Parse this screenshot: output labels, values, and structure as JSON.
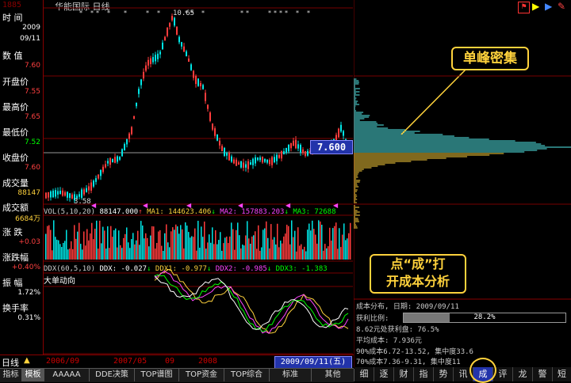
{
  "window": {
    "title": "华能国际 日线",
    "top_left_number": "1885"
  },
  "left_panel": {
    "items": [
      {
        "label": "时  间",
        "value": "2009"
      },
      {
        "label": "",
        "value": "09/11"
      },
      {
        "label": "数  值",
        "value": "7.60"
      },
      {
        "label": "开盘价",
        "value": "7.55"
      },
      {
        "label": "最高价",
        "value": "7.65"
      },
      {
        "label": "最低价",
        "value": "7.52"
      },
      {
        "label": "收盘价",
        "value": "7.60"
      },
      {
        "label": "成交量",
        "value": "88147"
      },
      {
        "label": "成交额",
        "value": "6684万"
      },
      {
        "label": "涨  跌",
        "value": "+0.03"
      },
      {
        "label": "涨跌幅",
        "value": "+0.40%"
      },
      {
        "label": "振  幅",
        "value": "1.72%"
      },
      {
        "label": "换手率",
        "value": "0.31%"
      }
    ]
  },
  "chart": {
    "peak_label": "10.65",
    "low_label": "3.58",
    "price_tag": "7.600",
    "vol_line": {
      "name": "VOL(5,10,20)",
      "v1": "88147.000",
      "ma1": "MA1: 144623.406",
      "ma2": "MA2: 157883.203",
      "ma3": "MA3: 72688"
    },
    "ddx_line": {
      "name": "DDX(60,5,10)",
      "ddx": "DDX: -0.027",
      "ddx1": "DDX1: -0.977",
      "ddx2": "DDX2: -0.985",
      "ddx3": "DDX3: -1.383"
    },
    "big_order_label": "大单动向"
  },
  "callouts": {
    "single_peak": "单峰密集",
    "click_cheng": "点“成”打\n开成本分析"
  },
  "cost_panel": {
    "line1": "成本分布, 日期: 2009/09/11",
    "profit_label": "获利比例:",
    "profit_value": "28.2%",
    "profit_fraction": 0.282,
    "line3": "8.62元处获利盘: 76.5%",
    "line4": "平均成本: 7.936元",
    "line5": "90%成本6.72-13.52, 集中度33.6",
    "line6": "70%成本7.36-9.31, 集中度11"
  },
  "timeline": {
    "period": "日线",
    "dates": [
      "2006/09",
      "2007/05",
      "09",
      "2008"
    ],
    "current_date": "2009/09/11(五)"
  },
  "bottom_tabs": [
    "指标",
    "模板",
    "AAAAA",
    "DDE决策",
    "TOP谱图",
    "TOP资金",
    "TOP综合",
    "标准",
    "其他"
  ],
  "right_tabs": [
    "细",
    "逐",
    "财",
    "指",
    "势",
    "讯",
    "成",
    "评",
    "龙",
    "警",
    "短"
  ],
  "colors": {
    "up": "#ff3c3c",
    "down": "#00e5e5",
    "accent": "#ffd23c",
    "frame": "#990000"
  }
}
